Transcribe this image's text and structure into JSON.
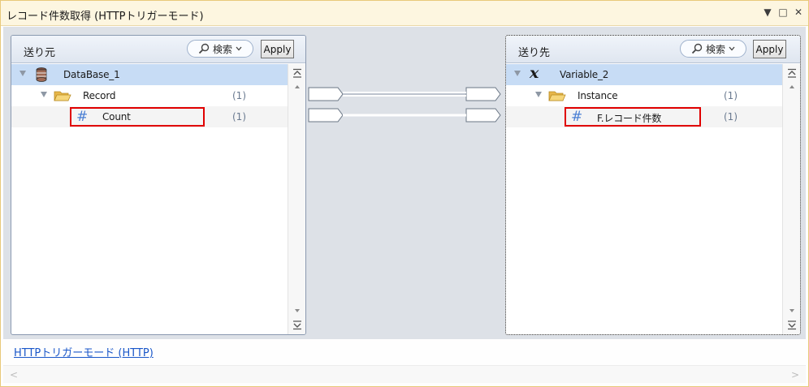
{
  "window": {
    "title": "レコード件数取得 (HTTPトリガーモード)",
    "controls": [
      "▼",
      "□",
      "✕"
    ]
  },
  "source": {
    "title": "送り元",
    "search_label": "検索",
    "apply_label": "Apply",
    "rows": [
      {
        "label": "DataBase_1",
        "count": "",
        "icon": "database-icon"
      },
      {
        "label": "Record",
        "count": "(1)",
        "icon": "folder-icon"
      },
      {
        "label": "Count",
        "count": "(1)",
        "icon": "hash-icon"
      }
    ]
  },
  "destination": {
    "title": "送り先",
    "search_label": "検索",
    "apply_label": "Apply",
    "rows": [
      {
        "label": "Variable_2",
        "count": "",
        "icon": "variable-x-icon"
      },
      {
        "label": "Instance",
        "count": "(1)",
        "icon": "folder-icon"
      },
      {
        "label": "F.レコード件数",
        "count": "(1)",
        "icon": "hash-icon"
      }
    ]
  },
  "footer": {
    "link": "HTTPトリガーモード (HTTP)"
  },
  "colors": {
    "selected_row": "#c7dcf5",
    "highlight_box": "#e00000",
    "link": "#1a57c9"
  }
}
